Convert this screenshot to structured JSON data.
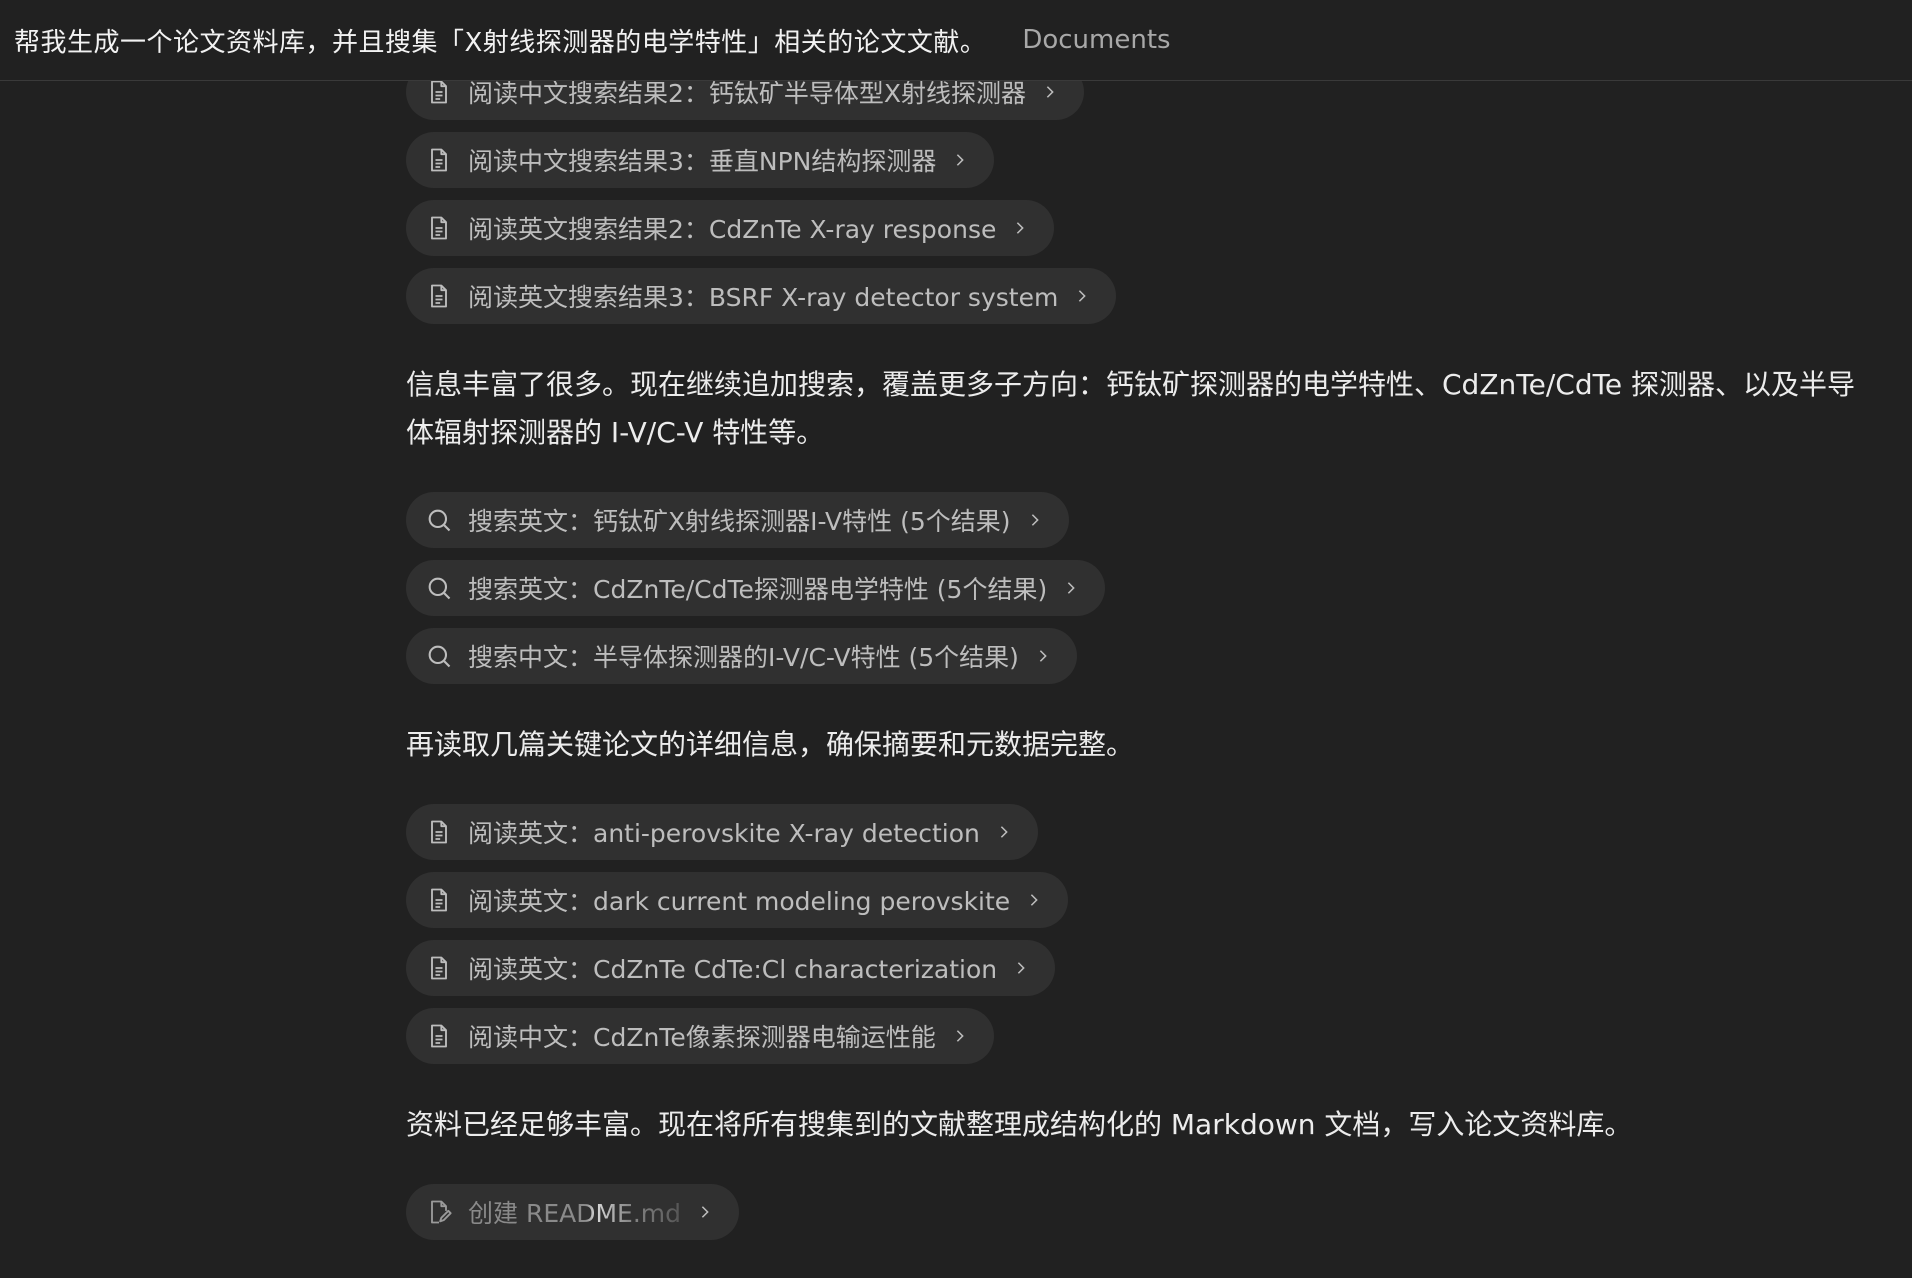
{
  "header": {
    "title": "帮我生成一个论文资料库，并且搜集「X射线探测器的电学特性」相关的论文文献。",
    "breadcrumb": "Documents"
  },
  "steps_group1": [
    {
      "icon": "document-icon",
      "label": "阅读中文搜索结果2：钙钛矿半导体型X射线探测器"
    },
    {
      "icon": "document-icon",
      "label": "阅读中文搜索结果3：垂直NPN结构探测器"
    },
    {
      "icon": "document-icon",
      "label": "阅读英文搜索结果2：CdZnTe X-ray response"
    },
    {
      "icon": "document-icon",
      "label": "阅读英文搜索结果3：BSRF X-ray detector system"
    }
  ],
  "message1": "信息丰富了很多。现在继续追加搜索，覆盖更多子方向：钙钛矿探测器的电学特性、CdZnTe/CdTe 探测器、以及半导体辐射探测器的 I-V/C-V 特性等。",
  "steps_group2": [
    {
      "icon": "search-icon",
      "label": "搜索英文：钙钛矿X射线探测器I-V特性 (5个结果)"
    },
    {
      "icon": "search-icon",
      "label": "搜索英文：CdZnTe/CdTe探测器电学特性 (5个结果)"
    },
    {
      "icon": "search-icon",
      "label": "搜索中文：半导体探测器的I-V/C-V特性 (5个结果)"
    }
  ],
  "message2": "再读取几篇关键论文的详细信息，确保摘要和元数据完整。",
  "steps_group3": [
    {
      "icon": "document-icon",
      "label": "阅读英文：anti-perovskite X-ray detection"
    },
    {
      "icon": "document-icon",
      "label": "阅读英文：dark current modeling perovskite"
    },
    {
      "icon": "document-icon",
      "label": "阅读英文：CdZnTe CdTe:Cl characterization"
    },
    {
      "icon": "document-icon",
      "label": "阅读中文：CdZnTe像素探测器电输运性能"
    }
  ],
  "message3": "资料已经足够丰富。现在将所有搜集到的文献整理成结构化的 Markdown 文档，写入论文资料库。",
  "steps_group4": [
    {
      "icon": "edit-file-icon",
      "label": "创建 README.md"
    }
  ],
  "colors": {
    "background": "#212121",
    "pill": "#303030",
    "text": "#ececec",
    "muted": "#bdbdbd"
  }
}
